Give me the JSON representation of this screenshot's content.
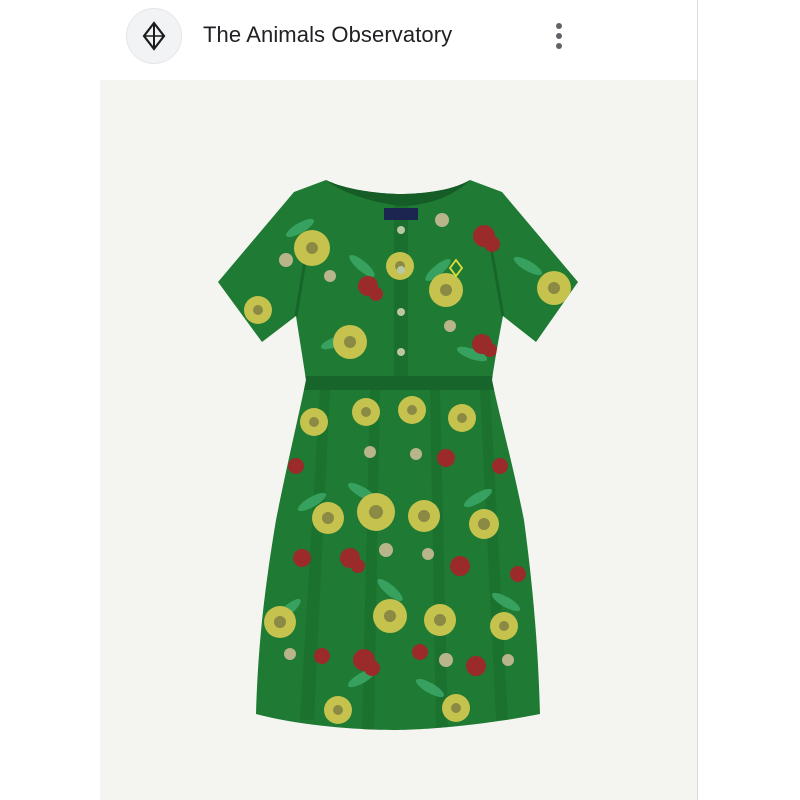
{
  "header": {
    "brand_name": "The Animals Observatory",
    "logo_icon": "diamond-logo-icon",
    "menu_icon": "more-vert-icon"
  },
  "product_image": {
    "subject": "dress",
    "colors": {
      "background": "#f4f5f1",
      "fabric": "#1f7a33",
      "fabric_shadow": "#17652a",
      "flower_yellow": "#c6c24e",
      "flower_red": "#9b2a2a",
      "flower_pale": "#b8b58a",
      "leaf": "#3da868"
    }
  }
}
